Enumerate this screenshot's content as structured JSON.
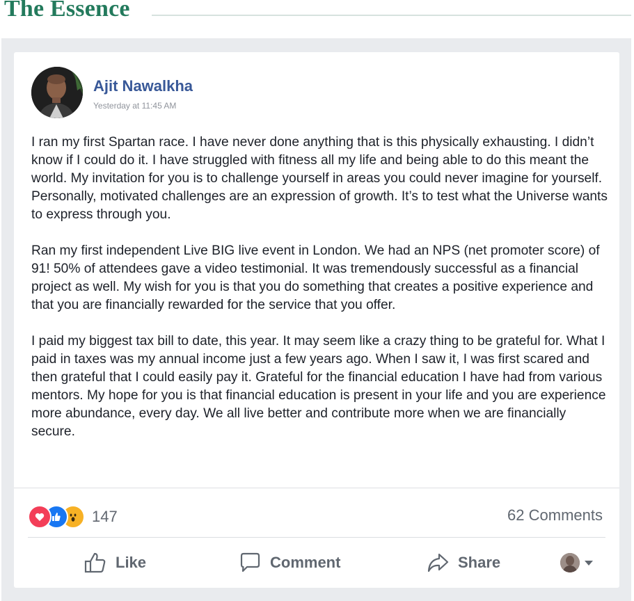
{
  "header": {
    "title": "The Essence"
  },
  "post": {
    "author": "Ajit Nawalkha",
    "timestamp": "Yesterday at 11:45 AM",
    "paragraphs": [
      "I ran my first Spartan race. I have never done anything that is this physically exhausting. I didn’t know if I could do it. I have struggled with fitness all my life and being able to do this meant the world. My invitation for you is to challenge yourself in areas you could never imagine for yourself. Personally, motivated challenges are an expression of growth. It’s to test what the Universe wants to express through you.",
      "Ran my first independent Live BIG live event in London. We had an NPS (net promoter score) of 91! 50% of attendees gave a video testimonial. It was tremendously successful as a financial project as well. My wish for you is that you do something that creates a positive experience and that you are financially rewarded for the service that you offer.",
      "I paid my biggest tax bill to date, this year. It may seem like a crazy thing to be grateful for. What I paid in taxes was my annual income just a few years ago. When I saw it, I was first scared and then grateful that I could easily pay it. Grateful for the financial education I have had from various mentors. My hope for you is that financial education is present in your life and you are experience more abundance, every day. We all live better and contribute more when we are financially secure."
    ],
    "reactions": {
      "icons": [
        "love",
        "like",
        "wow"
      ],
      "count": "147"
    },
    "comments": "62 Comments",
    "actions": {
      "like": "Like",
      "comment": "Comment",
      "share": "Share"
    }
  },
  "colors": {
    "brand_green": "#237a5c",
    "fb_blue": "#385898",
    "love": "#f33e58",
    "like": "#1877f2",
    "wow": "#f7b125"
  }
}
